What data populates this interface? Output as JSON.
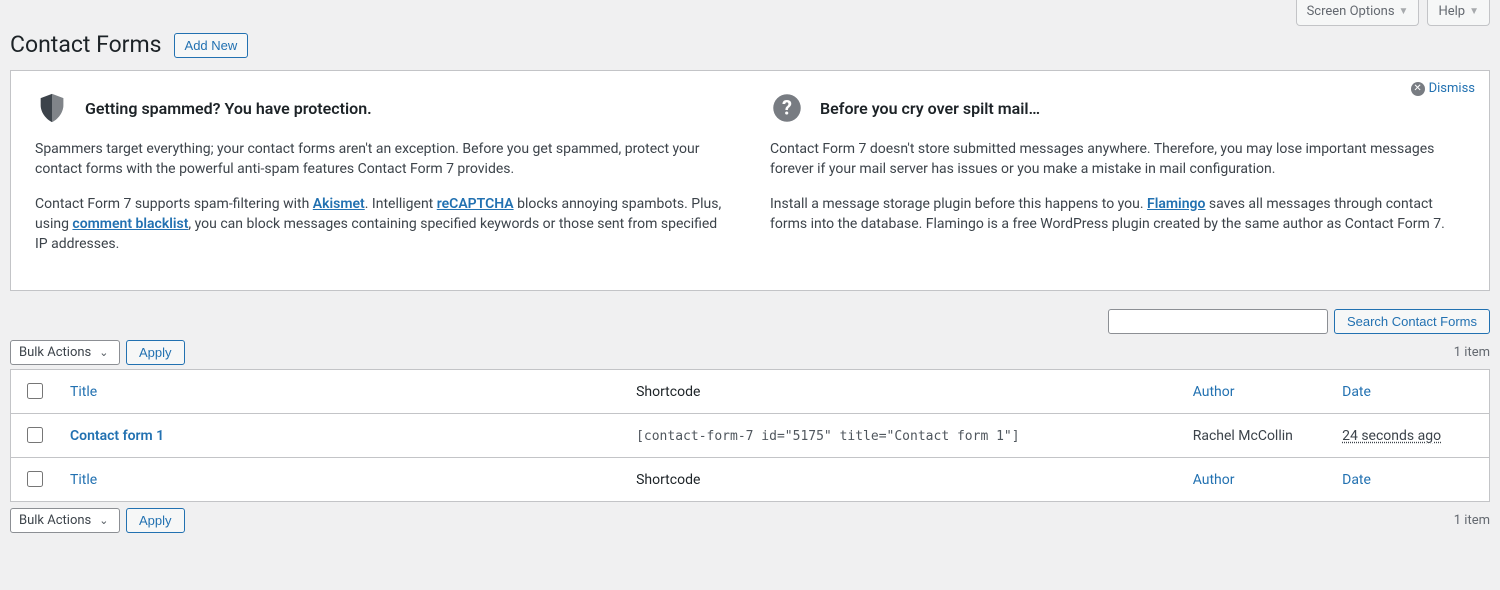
{
  "top": {
    "screen_options": "Screen Options",
    "help": "Help"
  },
  "header": {
    "title": "Contact Forms",
    "add_new": "Add New"
  },
  "panel": {
    "dismiss": "Dismiss",
    "col1": {
      "heading": "Getting spammed? You have protection.",
      "p1a": "Spammers target everything; your contact forms aren't an exception. Before you get spammed, protect your contact forms with the powerful anti-spam features Contact Form 7 provides.",
      "p2a": "Contact Form 7 supports spam-filtering with ",
      "akismet": "Akismet",
      "p2b": ". Intelligent ",
      "recaptcha": "reCAPTCHA",
      "p2c": " blocks annoying spambots. Plus, using ",
      "blacklist": "comment blacklist",
      "p2d": ", you can block messages containing specified keywords or those sent from specified IP addresses."
    },
    "col2": {
      "heading": "Before you cry over spilt mail…",
      "p1": "Contact Form 7 doesn't store submitted messages anywhere. Therefore, you may lose important messages forever if your mail server has issues or you make a mistake in mail configuration.",
      "p2a": "Install a message storage plugin before this happens to you. ",
      "flamingo": "Flamingo",
      "p2b": " saves all messages through contact forms into the database. Flamingo is a free WordPress plugin created by the same author as Contact Form 7."
    }
  },
  "search": {
    "button": "Search Contact Forms",
    "value": ""
  },
  "bulk": {
    "label": "Bulk Actions",
    "apply": "Apply"
  },
  "count_label": "1 item",
  "columns": {
    "title": "Title",
    "shortcode": "Shortcode",
    "author": "Author",
    "date": "Date"
  },
  "rows": [
    {
      "title": "Contact form 1",
      "shortcode": "[contact-form-7 id=\"5175\" title=\"Contact form 1\"]",
      "author": "Rachel McCollin",
      "date": "24 seconds ago"
    }
  ]
}
